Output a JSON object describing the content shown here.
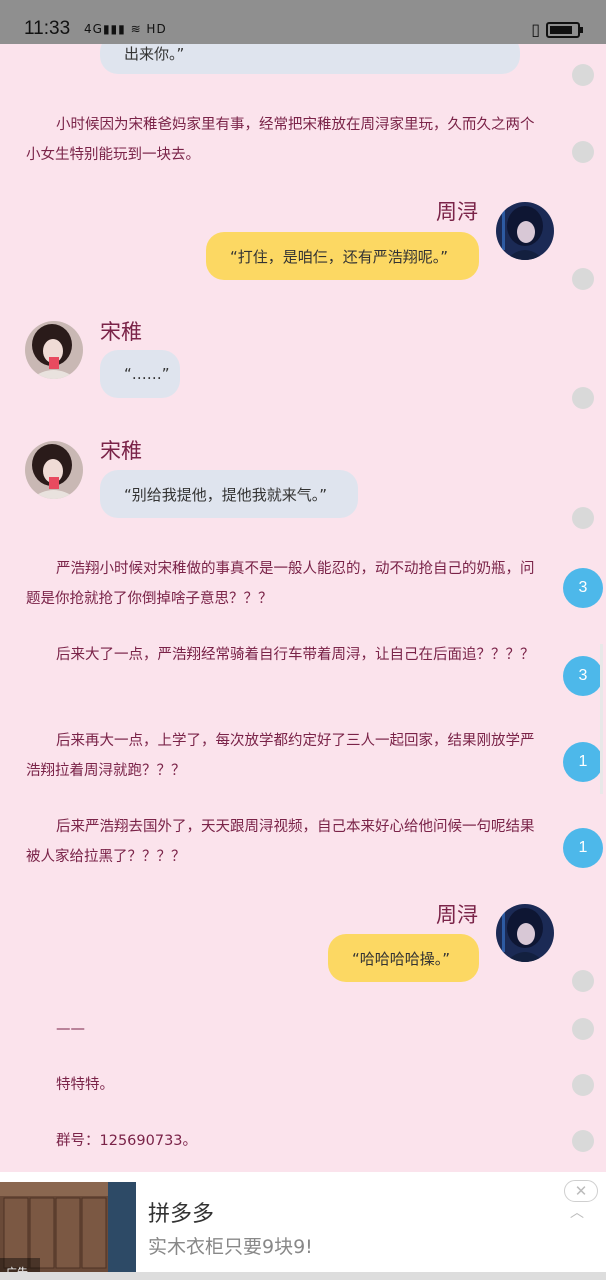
{
  "status_bar": {
    "time": "11:33",
    "network": "4G",
    "battery_level": 0.85
  },
  "chat": {
    "top_bubble": "出来你。”",
    "para1": "小时候因为宋稚爸妈家里有事，经常把宋稚放在周浔家里玩，久而久之两个小女生特别能玩到一块去。",
    "msg1": {
      "name": "周浔",
      "text": "“打住，是咱仨，还有严浩翔呢。”"
    },
    "msg2": {
      "name": "宋稚",
      "text": "“……”"
    },
    "msg3": {
      "name": "宋稚",
      "text": "“别给我提他，提他我就来气。”"
    },
    "para2": "严浩翔小时候对宋稚做的事真不是一般人能忍的，动不动抢自己的奶瓶，问题是你抢就抢了你倒掉啥子意思？？？",
    "para3": "后来大了一点，严浩翔经常骑着自行车带着周浔，让自己在后面追？？？？",
    "para4": "后来再大一点，上学了，每次放学都约定好了三人一起回家，结果刚放学严浩翔拉着周浔就跑？？？",
    "para5": "后来严浩翔去国外了，天天跟周浔视频，自己本来好心给他问候一句呢结果被人家给拉黑了？？？？",
    "msg4": {
      "name": "周浔",
      "text": "“哈哈哈哈操。”"
    },
    "dash": "——",
    "sign1": "特特特。",
    "sign2": "群号：125690733。"
  },
  "comment_counts": [
    "3",
    "3",
    "1",
    "1"
  ],
  "ad": {
    "brand": "拼多多",
    "desc": "实木衣柜只要9块9!",
    "tag": "广告",
    "close": "✕",
    "chevron": "︿"
  },
  "colors": {
    "background": "#fbe3ec",
    "text": "#7a2348",
    "bubble_grey": "#dfe4ee",
    "bubble_yellow": "#fcd863",
    "count_blue": "#4db8ea"
  }
}
